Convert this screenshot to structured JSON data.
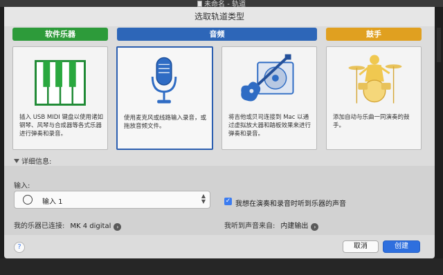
{
  "window": {
    "title": "未命名 - 轨道"
  },
  "dialog": {
    "title": "选取轨道类型"
  },
  "categories": [
    {
      "label": "软件乐器",
      "color": "#2d9b3a"
    },
    {
      "label": "音频",
      "color": "#2d66b8"
    },
    {
      "label": "鼓手",
      "color": "#e0a020"
    }
  ],
  "cards": [
    {
      "description": "插入 USB MIDI 键盘以使用诸如钢琴、风琴与合成器等各式乐器进行弹奏和录音。"
    },
    {
      "description": "使用麦克风或线路输入录音，或拖放音频文件。"
    },
    {
      "description": "将吉他或贝司连接到 Mac 以通过虚拟放大器和踏板效果来进行弹奏和录音。"
    },
    {
      "description": "添加自动与乐曲一同演奏的鼓手。"
    }
  ],
  "details": {
    "toggle_label": "详细信息:",
    "input_label": "输入:",
    "input_value": "输入 1",
    "monitor_label": "我想在演奏和录音时听到乐器的声音",
    "monitor_checked": true,
    "instrument_label": "我的乐器已连接:",
    "instrument_value": "MK 4 digital",
    "output_label": "我听到声音来自:",
    "output_value": "内建输出"
  },
  "buttons": {
    "help": "?",
    "cancel": "取消",
    "create": "创建"
  },
  "colors": {
    "accent": "#2e6fde",
    "selection": "#2b5eb0"
  }
}
